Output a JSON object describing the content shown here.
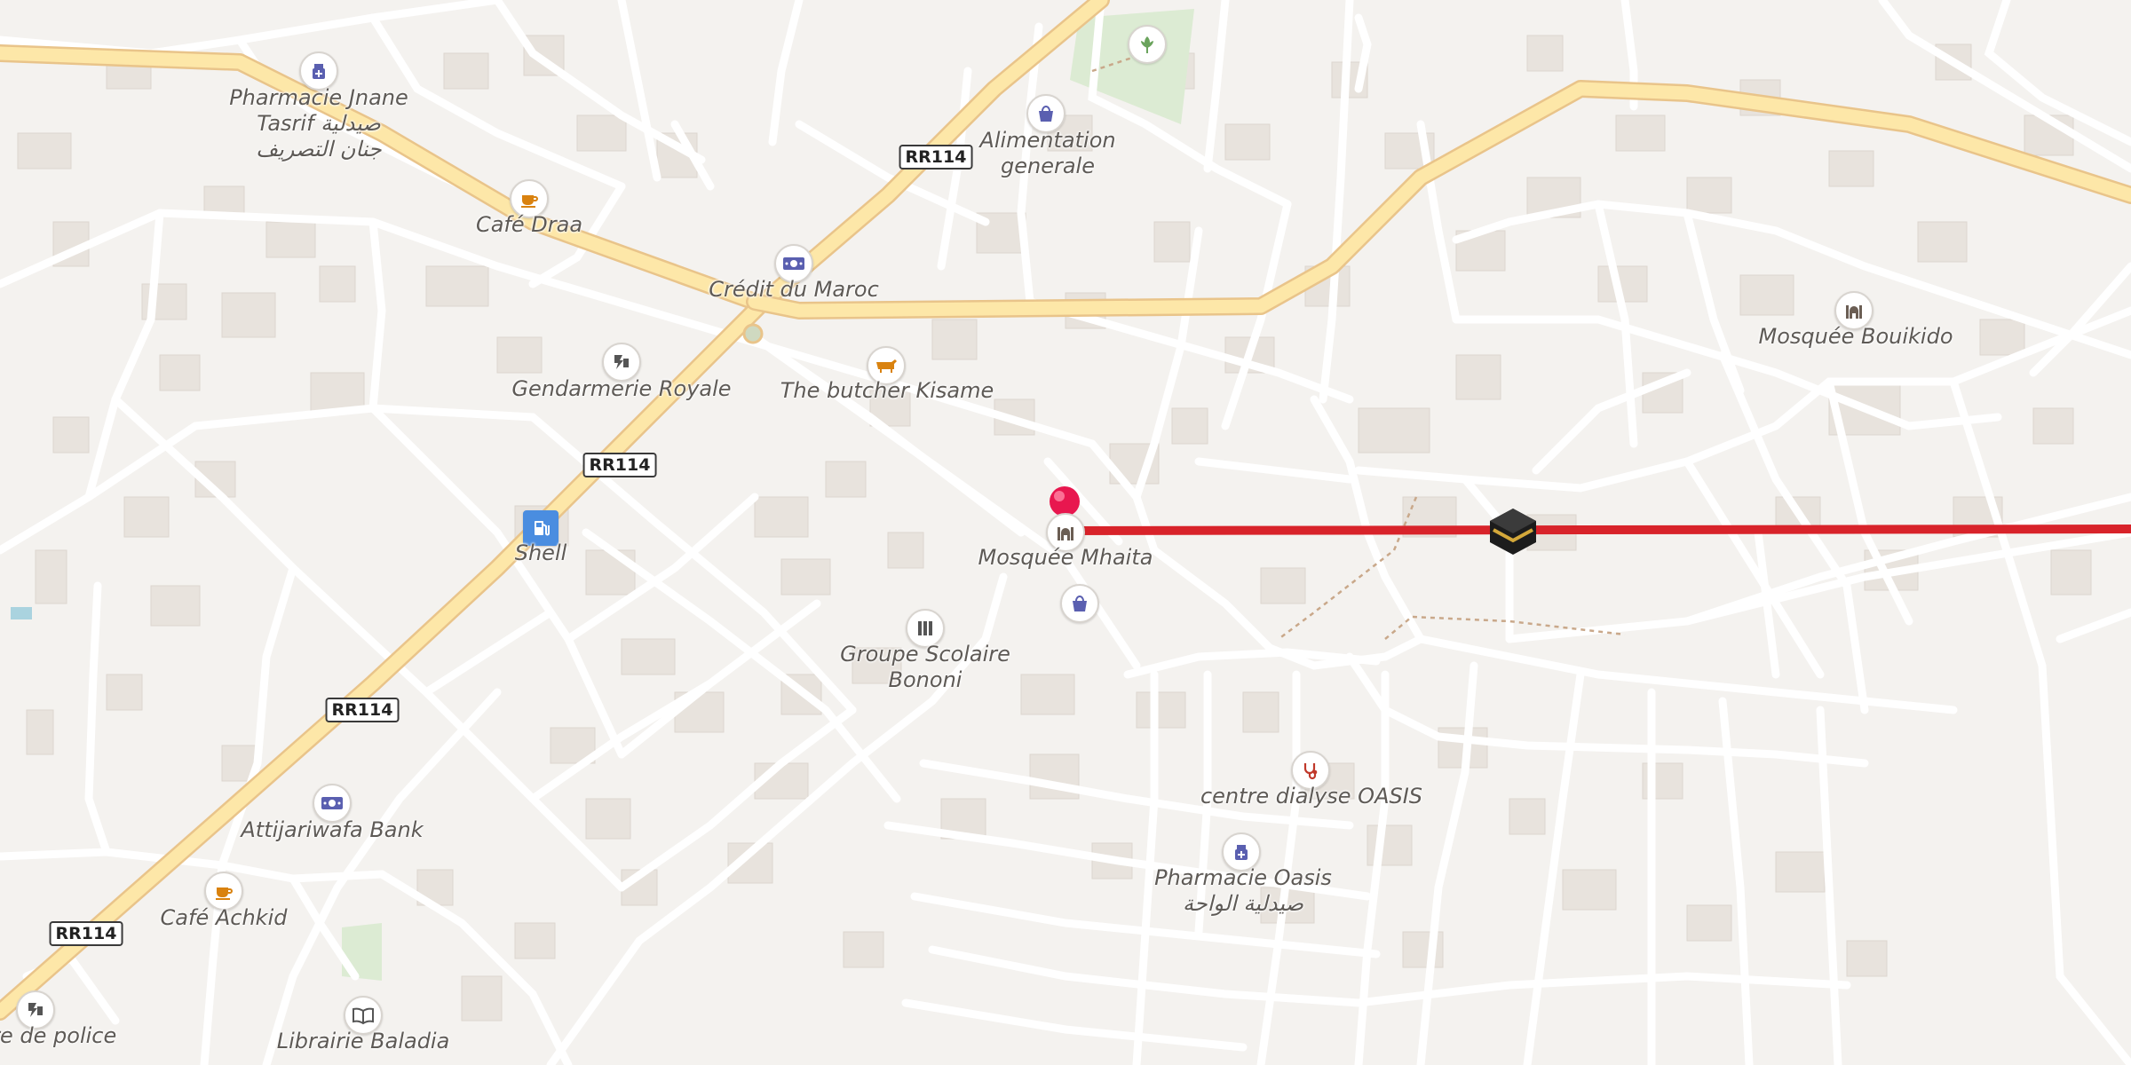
{
  "map": {
    "road_shield_text": "RR114",
    "route_color": "#d8232a",
    "pin_color": "#e8174f",
    "accent_blue": "#5a5fb0",
    "accent_orange": "#d9820f"
  },
  "pois": {
    "pharmacie_jnane": {
      "icon": "pharmacy-icon",
      "lines": [
        "Pharmacie Jnane",
        "Tasrif صيدلية",
        "جنان التصريف"
      ]
    },
    "cafe_draa": {
      "icon": "cafe-icon",
      "lines": [
        "Café Draa"
      ]
    },
    "credit_du_maroc": {
      "icon": "bank-icon",
      "lines": [
        "Crédit du Maroc"
      ]
    },
    "alimentation_generale": {
      "icon": "shop-icon",
      "lines": [
        "Alimentation",
        "generale"
      ]
    },
    "park": {
      "icon": "park-icon",
      "lines": []
    },
    "gendarmerie_royale": {
      "icon": "police-icon",
      "lines": [
        "Gendarmerie Royale"
      ]
    },
    "butcher_kisame": {
      "icon": "butcher-icon",
      "lines": [
        "The butcher Kisame"
      ]
    },
    "shell": {
      "icon": "fuel-icon",
      "lines": [
        "Shell"
      ]
    },
    "mosquee_mhaita": {
      "icon": "mosque-icon",
      "lines": [
        "Mosquée Mhaita"
      ]
    },
    "shop_2": {
      "icon": "shop-icon",
      "lines": []
    },
    "groupe_scolaire": {
      "icon": "school-icon",
      "lines": [
        "Groupe Scolaire",
        "Bononi"
      ]
    },
    "mosquee_bouikido": {
      "icon": "mosque-icon",
      "lines": [
        "Mosquée Bouikido"
      ]
    },
    "centre_dialyse": {
      "icon": "clinic-icon",
      "lines": [
        "centre dialyse OASIS"
      ]
    },
    "pharmacie_oasis": {
      "icon": "pharmacy-icon",
      "lines": [
        "Pharmacie Oasis",
        "صيدلية الواحة"
      ]
    },
    "attijariwafa": {
      "icon": "bank-icon",
      "lines": [
        "Attijariwafa Bank"
      ]
    },
    "cafe_achkid": {
      "icon": "cafe-icon",
      "lines": [
        "Café Achkid"
      ]
    },
    "police": {
      "icon": "police-icon",
      "lines": [
        "tre de police"
      ]
    },
    "librairie_baladia": {
      "icon": "book-icon",
      "lines": [
        "Librairie Baladia"
      ]
    }
  }
}
